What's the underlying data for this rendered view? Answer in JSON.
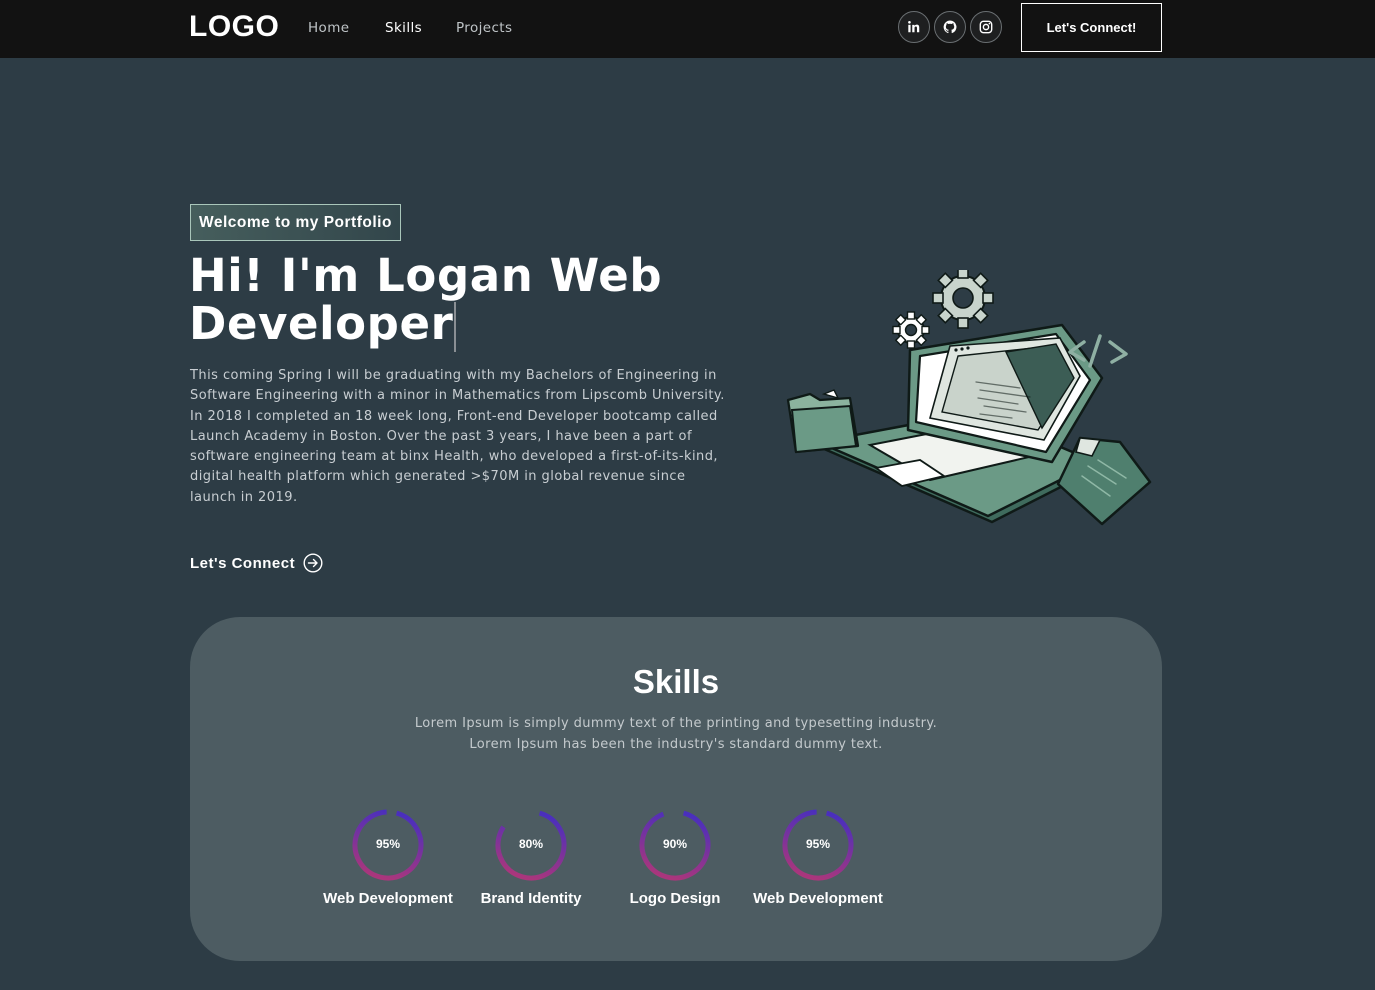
{
  "nav": {
    "logo": "LOGO",
    "links": [
      {
        "label": "Home",
        "active": false
      },
      {
        "label": "Skills",
        "active": true
      },
      {
        "label": "Projects",
        "active": false
      }
    ],
    "social": [
      {
        "icon": "linkedin-icon"
      },
      {
        "icon": "github-icon"
      },
      {
        "icon": "instagram-icon"
      }
    ],
    "connect_label": "Let's Connect!"
  },
  "hero": {
    "tagline": "Welcome to my Portfolio",
    "title": "Hi! I'm Logan Web Developer",
    "description": "This coming Spring I will be graduating with my Bachelors of Engineering in Software Engineering with a minor in Mathematics from Lipscomb University. In 2018 I completed an 18 week long, Front-end Developer bootcamp called Launch Academy in Boston. Over the past 3 years, I have been a part of software engineering team at binx Health, who developed a first-of-its-kind, digital health platform which generated >$70M in global revenue since launch in 2019.",
    "cta_label": "Let's Connect",
    "cta_icon": "arrow-circle-right-icon",
    "illustration": "laptop-code-illustration"
  },
  "skills": {
    "title": "Skills",
    "description_line1": "Lorem Ipsum is simply dummy text of the printing and typesetting industry.",
    "description_line2": "Lorem Ipsum has been the industry's standard dummy text.",
    "items": [
      {
        "percent_label": "95%",
        "value": 95,
        "name": "Web Development"
      },
      {
        "percent_label": "80%",
        "value": 80,
        "name": "Brand Identity"
      },
      {
        "percent_label": "90%",
        "value": 90,
        "name": "Logo Design"
      },
      {
        "percent_label": "95%",
        "value": 95,
        "name": "Web Development"
      }
    ]
  },
  "colors": {
    "page_bg": "#2d3c45",
    "navbar_bg": "#121212",
    "card_bg": "#4d5c62",
    "ring_start": "#aa367c",
    "ring_end": "#4a2fbd",
    "accent_green": "#5f8c76"
  }
}
